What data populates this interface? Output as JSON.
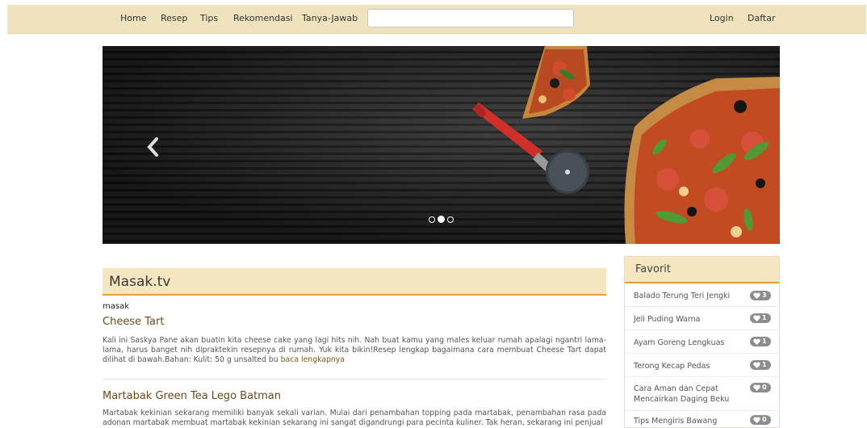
{
  "nav": {
    "items": [
      "Home",
      "Resep",
      "Tips",
      "Rekomendasi",
      "Tanya-Jawab"
    ],
    "search_placeholder": "",
    "login": "Login",
    "register": "Daftar"
  },
  "carousel": {
    "slide_count": 3,
    "active_slide": 2,
    "prev_icon": "chevron-left-icon",
    "image": "pizza-slices-and-pizza-cutter-photo"
  },
  "main": {
    "title": "Masak.tv",
    "tagline": "masak",
    "articles": [
      {
        "title": "Cheese Tart",
        "body": "Kali ini Saskya Pane akan buatin kita cheese cake yang lagi hits nih. Nah buat kamu yang males keluar rumah apalagi ngantri lama-lama, harus banget nih dipraktekin resepnya di rumah. Yuk kita bikin!Resep lengkap bagaimana cara membuat Cheese Tart dapat dilihat di bawah.Bahan: Kulit: 50 g unsalted bu",
        "read_more": "baca lengkapnya"
      },
      {
        "title": "Martabak Green Tea Lego Batman",
        "body": "Martabak kekinian sekarang memiliki banyak sekali varian. Mulai dari penambahan topping pada martabak, penambahan rasa pada adonan martabak membuat martabak kekinian sekarang ini sangat digandrungi para pecinta kuliner. Tak heran, sekarang ini penjual",
        "read_more": ""
      }
    ]
  },
  "favorites": {
    "title": "Favorit",
    "badge_icon": "heart-icon",
    "items": [
      {
        "label": "Balado Terung Teri Jengki",
        "count": "3"
      },
      {
        "label": "Jeli Puding Warna",
        "count": "1"
      },
      {
        "label": "Ayam Goreng Lengkuas",
        "count": "1"
      },
      {
        "label": "Terong Kecap Pedas",
        "count": "1"
      },
      {
        "label": "Cara Aman dan Cepat Mencairkan Daging Beku",
        "count": "0"
      },
      {
        "label": "Tips Mengiris Bawang",
        "count": "0"
      }
    ]
  },
  "colors": {
    "navbar_bg": "#efe3bd",
    "panel_bg": "#f3e6c0",
    "accent": "#e0a23a",
    "article_title": "#6b4a1a",
    "badge": "#8d8d8d"
  }
}
